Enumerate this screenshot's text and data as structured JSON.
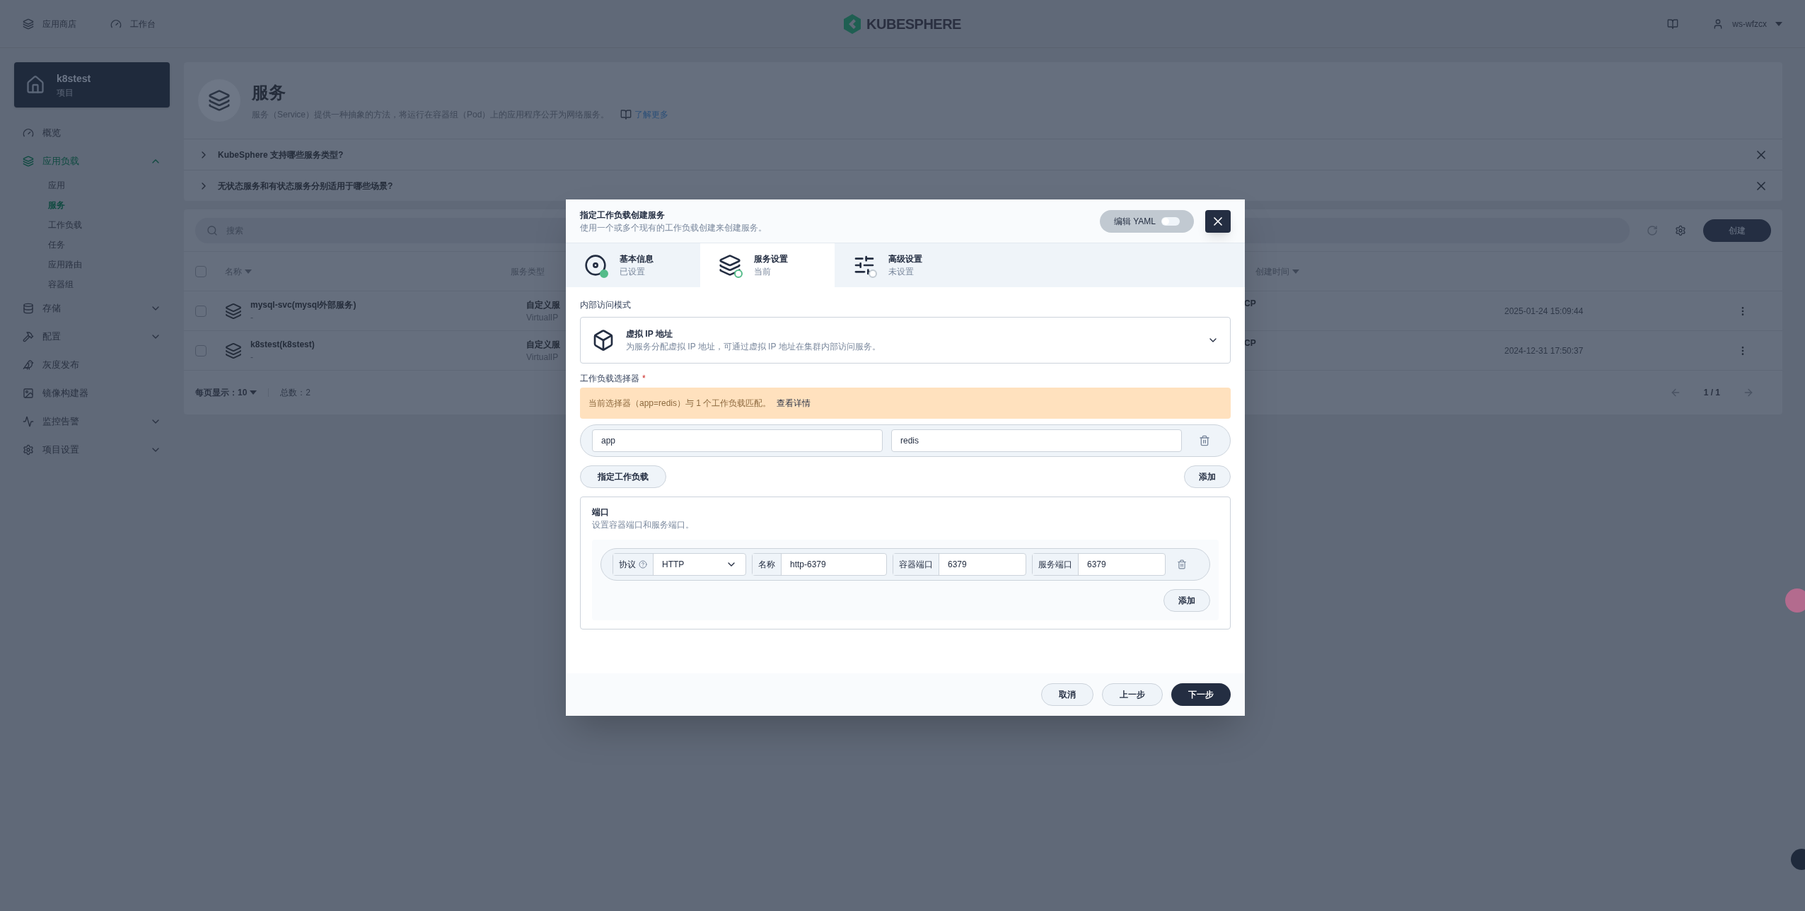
{
  "topbar": {
    "nav": [
      {
        "label": "应用商店"
      },
      {
        "label": "工作台"
      }
    ],
    "logo": "KUBESPHERE",
    "user": "ws-wfzcx"
  },
  "sidebar": {
    "project": {
      "name": "k8stest",
      "type": "项目"
    },
    "items": [
      {
        "label": "概览",
        "kind": "link",
        "selected": false
      },
      {
        "label": "应用负载",
        "kind": "group",
        "selected": true,
        "expanded": true,
        "children": [
          {
            "label": "应用",
            "selected": false
          },
          {
            "label": "服务",
            "selected": true
          },
          {
            "label": "工作负载",
            "selected": false
          },
          {
            "label": "任务",
            "selected": false
          },
          {
            "label": "应用路由",
            "selected": false
          },
          {
            "label": "容器组",
            "selected": false
          }
        ]
      },
      {
        "label": "存储",
        "kind": "group",
        "selected": false,
        "expanded": false
      },
      {
        "label": "配置",
        "kind": "group",
        "selected": false,
        "expanded": false
      },
      {
        "label": "灰度发布",
        "kind": "link",
        "selected": false
      },
      {
        "label": "镜像构建器",
        "kind": "link",
        "selected": false
      },
      {
        "label": "监控告警",
        "kind": "group",
        "selected": false,
        "expanded": false
      },
      {
        "label": "项目设置",
        "kind": "group",
        "selected": false,
        "expanded": false
      }
    ]
  },
  "page": {
    "title": "服务",
    "description": "服务（Service）提供一种抽象的方法，将运行在容器组（Pod）上的应用程序公开为网络服务。",
    "learn_more": "了解更多",
    "faqs": [
      {
        "question": "KubeSphere 支持哪些服务类型?",
        "expanded": false
      },
      {
        "question": "无状态服务和有状态服务分别适用于哪些场景?",
        "expanded": false
      }
    ]
  },
  "table": {
    "search_placeholder": "搜索",
    "create_button": "创建",
    "header_checked": false,
    "columns": {
      "name": "名称",
      "type": "服务类型",
      "created": "创建时间"
    },
    "rows": [
      {
        "name": "mysql-svc(mysql外部服务)",
        "sub": "-",
        "type": "自定义服",
        "type_sub": "VirtualIP",
        "column_3": "CP",
        "created": "2025-01-24 15:09:44",
        "selected": false
      },
      {
        "name": "k8stest(k8stest)",
        "sub": "-",
        "type": "自定义服",
        "type_sub": "VirtualIP",
        "column_3": "CP",
        "created": "2024-12-31 17:50:37",
        "selected": false
      }
    ],
    "page_size_label": "每页显示：",
    "page_size": "10",
    "total": "总数：2",
    "page": "1 / 1"
  },
  "modal": {
    "title": "指定工作负载创建服务",
    "subtitle": "使用一个或多个现有的工作负载创建来创建服务。",
    "yaml_toggle": {
      "label": "编辑 YAML",
      "on": false
    },
    "steps": [
      {
        "title": "基本信息",
        "status_text": "已设置",
        "completed": true,
        "selected": false
      },
      {
        "title": "服务设置",
        "status_text": "当前",
        "completed": false,
        "selected": true
      },
      {
        "title": "高级设置",
        "status_text": "未设置",
        "completed": false,
        "selected": false
      }
    ],
    "access_mode": {
      "label": "内部访问模式",
      "value": "虚拟 IP 地址",
      "description": "为服务分配虚拟 IP 地址，可通过虚拟 IP 地址在集群内部访问服务。"
    },
    "selector": {
      "label": "工作负载选择器",
      "required_mark": "*",
      "notice": "当前选择器（app=redis）与 1 个工作负载匹配。",
      "notice_link": "查看详情",
      "pairs": [
        {
          "key": "app",
          "value": "redis"
        }
      ],
      "specify_button": "指定工作负载",
      "add_button": "添加"
    },
    "ports": {
      "title": "端口",
      "description": "设置容器端口和服务端口。",
      "rows": [
        {
          "protocol_label": "协议",
          "protocol": "HTTP",
          "name_label": "名称",
          "name": "http-6379",
          "container_port_label": "容器端口",
          "container_port": "6379",
          "service_port_label": "服务端口",
          "service_port": "6379"
        }
      ],
      "add_button": "添加"
    },
    "footer": [
      {
        "label": "取消",
        "kind": "secondary"
      },
      {
        "label": "上一步",
        "kind": "secondary"
      },
      {
        "label": "下一步",
        "kind": "primary"
      }
    ]
  }
}
